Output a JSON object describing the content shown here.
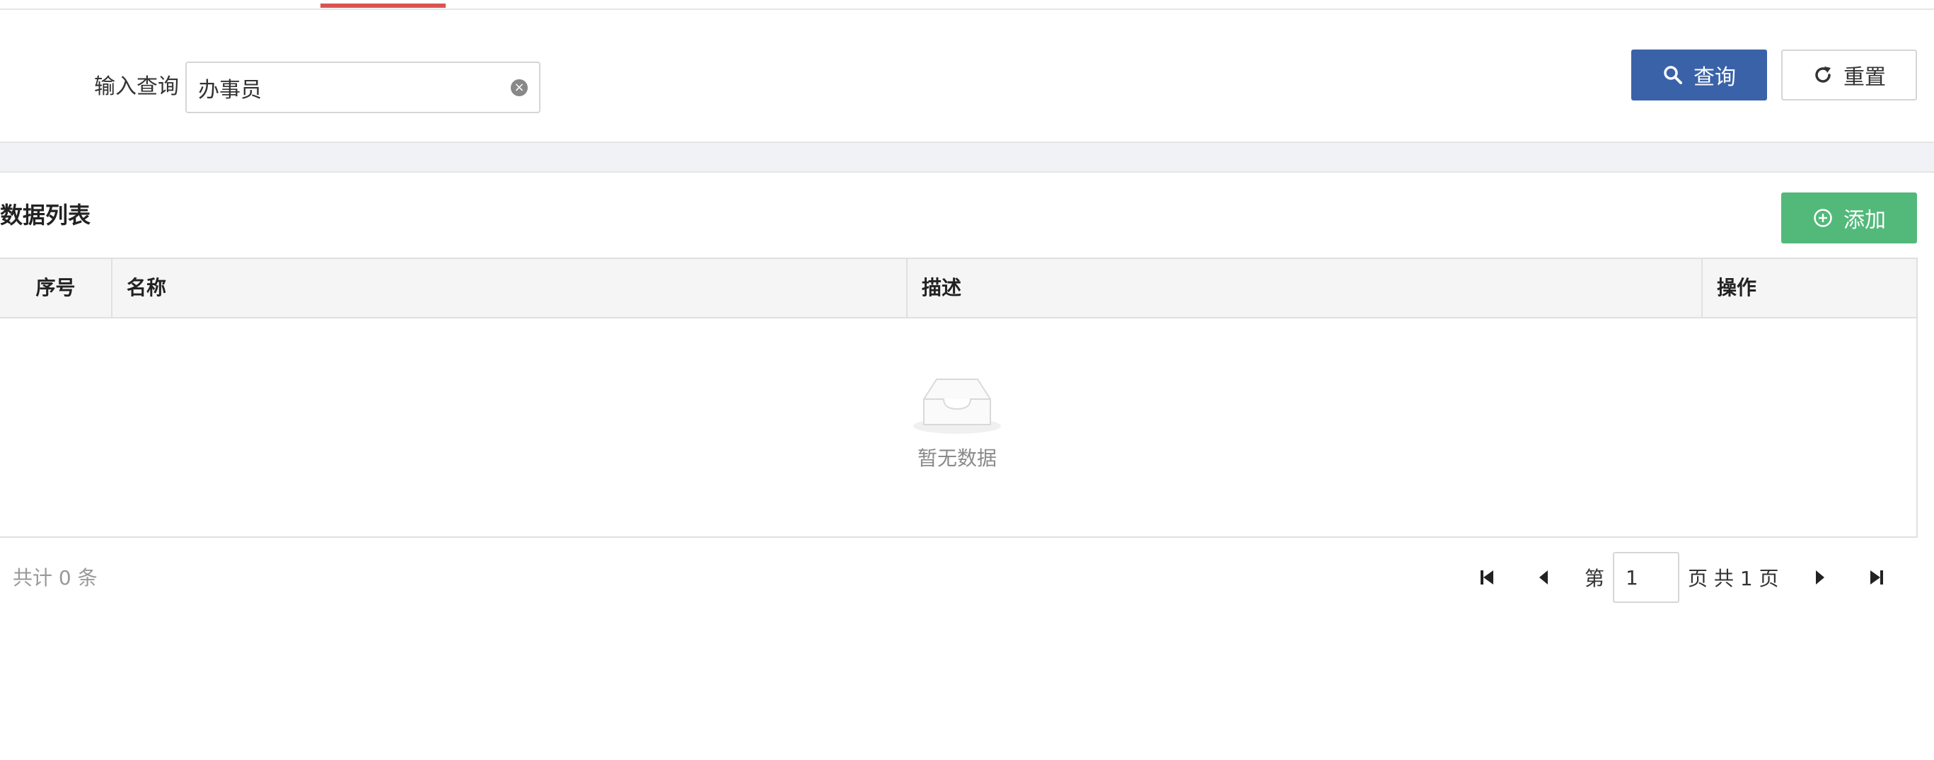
{
  "query": {
    "label": "输入查询",
    "input_value": "办事员",
    "search_label": "查询",
    "reset_label": "重置"
  },
  "list": {
    "title": "数据列表",
    "add_label": "添加",
    "columns": [
      "序号",
      "名称",
      "描述",
      "操作"
    ],
    "empty_text": "暂无数据"
  },
  "pagination": {
    "total_text": "共计 0 条",
    "page_prefix": "第",
    "current_page": "1",
    "page_suffix": "页 共 1 页"
  },
  "colors": {
    "primary": "#3a62a8",
    "success": "#52b97a",
    "active_tab": "#d9534f"
  },
  "icons": [
    "clear-icon",
    "search-icon",
    "refresh-icon",
    "add-circle-icon",
    "empty-inbox-icon",
    "first-page-icon",
    "prev-page-icon",
    "next-page-icon",
    "last-page-icon"
  ]
}
